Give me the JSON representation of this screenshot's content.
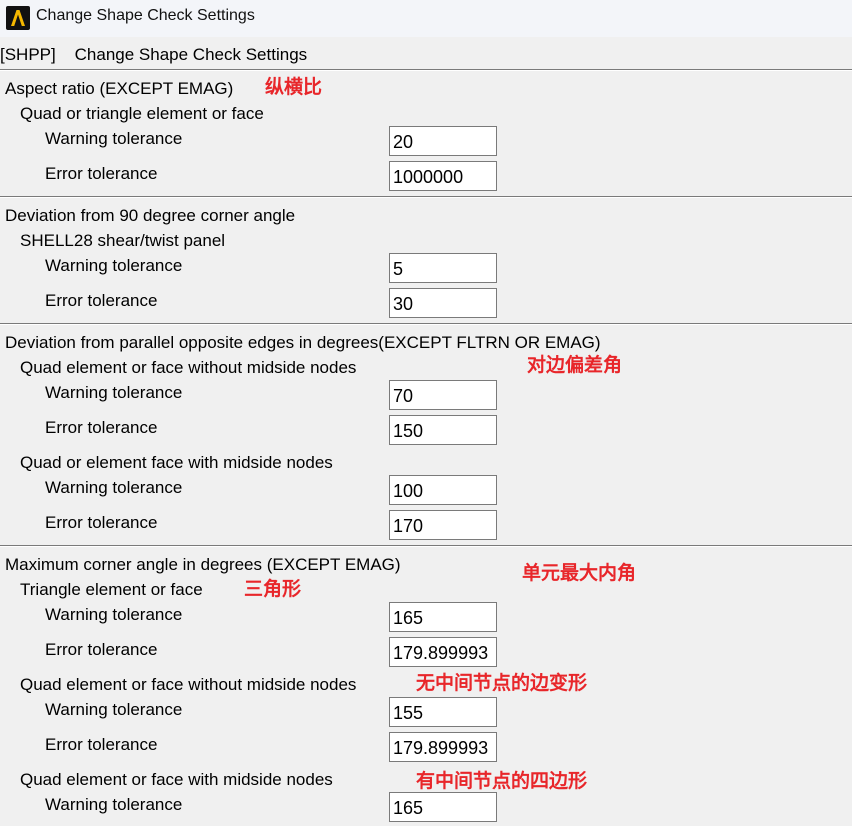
{
  "window": {
    "title": "Change Shape Check Settings"
  },
  "command": {
    "code": "[SHPP]",
    "title": "Change Shape Check Settings"
  },
  "aspect": {
    "header": "Aspect ratio  (EXCEPT EMAG)",
    "note": "纵横比",
    "sub": "Quad or triangle element or face",
    "warn_label": "Warning tolerance",
    "warn_value": "20",
    "err_label": "Error tolerance",
    "err_value": "1000000"
  },
  "deviation90": {
    "header": "Deviation from 90 degree corner angle",
    "sub": "SHELL28 shear/twist panel",
    "warn_label": "Warning tolerance",
    "warn_value": "5",
    "err_label": "Error tolerance",
    "err_value": "30"
  },
  "parallel": {
    "header": "Deviation from parallel opposite edges in degrees(EXCEPT FLTRN OR EMAG)",
    "sub1": "Quad element or face without midside nodes",
    "note": "对边偏差角",
    "warn1_label": "Warning tolerance",
    "warn1_value": "70",
    "err1_label": "Error tolerance",
    "err1_value": "150",
    "sub2": "Quad or element face with midside nodes",
    "warn2_label": "Warning tolerance",
    "warn2_value": "100",
    "err2_label": "Error tolerance",
    "err2_value": "170"
  },
  "maxangle": {
    "header": "Maximum corner angle in degrees (EXCEPT EMAG)",
    "note": "单元最大内角",
    "tri_sub": "Triangle element or face",
    "tri_note": "三角形",
    "tri_warn_label": "Warning tolerance",
    "tri_warn_value": "165",
    "tri_err_label": "Error tolerance",
    "tri_err_value": "179.899993",
    "quad_sub": "Quad element or face without midside nodes",
    "quad_note": "无中间节点的边变形",
    "quad_warn_label": "Warning tolerance",
    "quad_warn_value": "155",
    "quad_err_label": "Error tolerance",
    "quad_err_value": "179.899993",
    "quadmid_sub": "Quad element or face with midside nodes",
    "quadmid_note": "有中间节点的四边形",
    "quadmid_warn_label": "Warning tolerance",
    "quadmid_warn_value": "165"
  }
}
